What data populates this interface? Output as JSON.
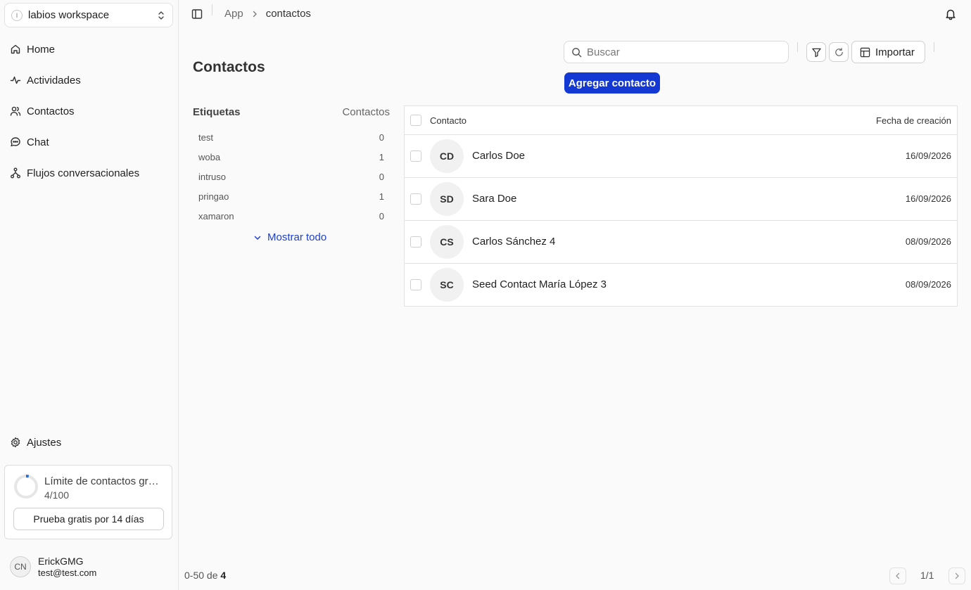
{
  "workspace": {
    "avatar_letter": "l",
    "name": "labios workspace"
  },
  "nav": [
    {
      "label": "Home",
      "icon": "home-icon"
    },
    {
      "label": "Actividades",
      "icon": "activity-icon"
    },
    {
      "label": "Contactos",
      "icon": "users-icon"
    },
    {
      "label": "Chat",
      "icon": "chat-icon"
    },
    {
      "label": "Flujos conversacionales",
      "icon": "workflow-icon"
    }
  ],
  "settings": {
    "label": "Ajustes",
    "icon": "gear-icon"
  },
  "limit": {
    "title": "Límite de contactos gratuitos",
    "count": "4/100",
    "progress": 0.04,
    "trial_button": "Prueba gratis por 14 días"
  },
  "user": {
    "initials": "CN",
    "name": "ErickGMG",
    "email": "test@test.com"
  },
  "breadcrumb": {
    "root": "App",
    "current": "contactos"
  },
  "page": {
    "title": "Contactos"
  },
  "search": {
    "placeholder": "Buscar",
    "value": ""
  },
  "toolbar": {
    "import_label": "Importar",
    "add_label": "Agregar contacto"
  },
  "tags": {
    "header_label": "Etiquetas",
    "header_count": "Contactos",
    "items": [
      {
        "name": "test",
        "count": "0"
      },
      {
        "name": "woba",
        "count": "1"
      },
      {
        "name": "intruso",
        "count": "0"
      },
      {
        "name": "pringao",
        "count": "1"
      },
      {
        "name": "xamaron",
        "count": "0"
      }
    ],
    "show_all": "Mostrar todo"
  },
  "table": {
    "col_contact": "Contacto",
    "col_date": "Fecha de creación",
    "rows": [
      {
        "initials": "CD",
        "name": "Carlos Doe",
        "date": "16/09/2026"
      },
      {
        "initials": "SD",
        "name": "Sara Doe",
        "date": "16/09/2026"
      },
      {
        "initials": "CS",
        "name": "Carlos Sánchez 4",
        "date": "08/09/2026"
      },
      {
        "initials": "SC",
        "name": "Seed Contact María López 3",
        "date": "08/09/2026"
      }
    ]
  },
  "pagination": {
    "range_prefix": "0-50 de ",
    "total": "4",
    "page": "1/1"
  },
  "colors": {
    "accent": "#1338d4",
    "link": "#1d3fcf"
  }
}
